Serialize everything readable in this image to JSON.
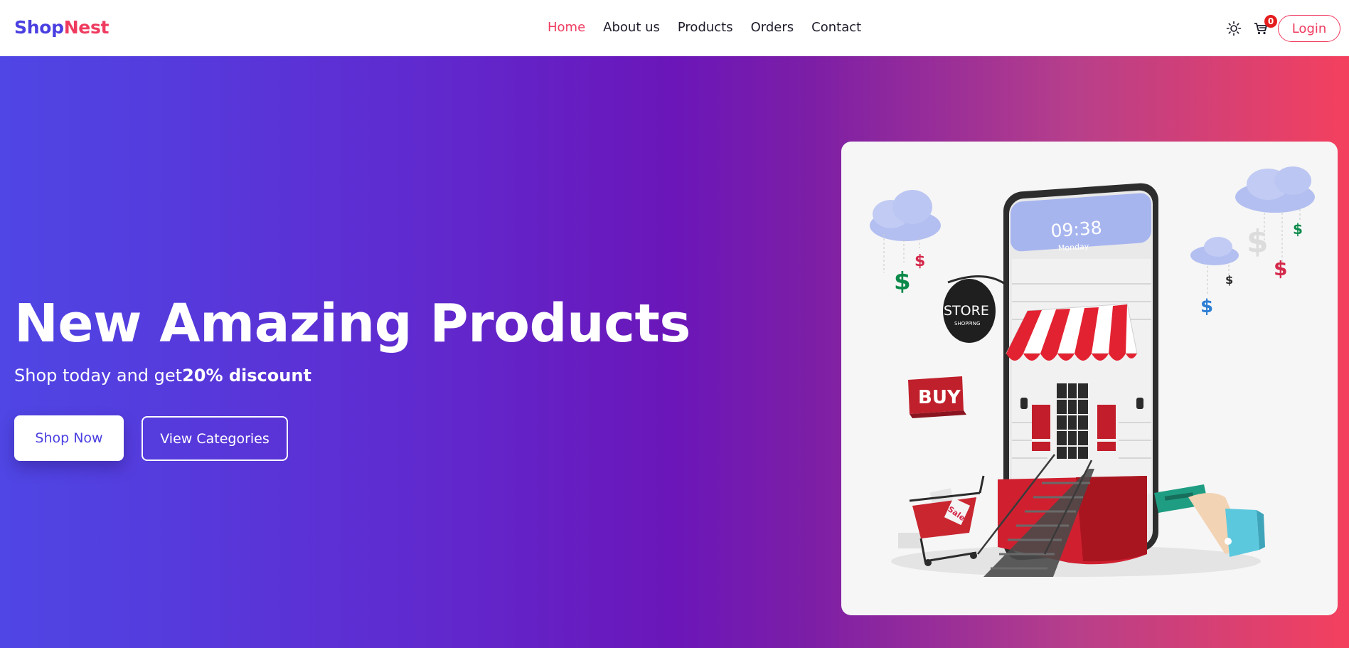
{
  "brand": {
    "part1": "Shop",
    "part2": "Nest"
  },
  "nav": {
    "items": [
      {
        "label": "Home",
        "active": true
      },
      {
        "label": "About us",
        "active": false
      },
      {
        "label": "Products",
        "active": false
      },
      {
        "label": "Orders",
        "active": false
      },
      {
        "label": "Contact",
        "active": false
      }
    ]
  },
  "toolbar": {
    "theme_icon": "sun-icon",
    "cart_icon": "cart-icon",
    "cart_count": "0",
    "login_label": "Login"
  },
  "hero": {
    "title": "New Amazing Products",
    "subtitle_prefix": "Shop today and get",
    "subtitle_highlight": "20% discount",
    "primary_button": "Shop Now",
    "secondary_button": "View Categories"
  },
  "illustration": {
    "phone_time": "09:38",
    "phone_day": "Monday",
    "store_sign": "STORE",
    "store_sign_sub": "SHOPPING",
    "buy_sign": "BUY",
    "sale_tag": "Sale",
    "currency_symbol": "$"
  },
  "colors": {
    "brand_primary": "#4a3fe0",
    "brand_accent": "#ef3b5f",
    "badge": "#e41c1c"
  }
}
